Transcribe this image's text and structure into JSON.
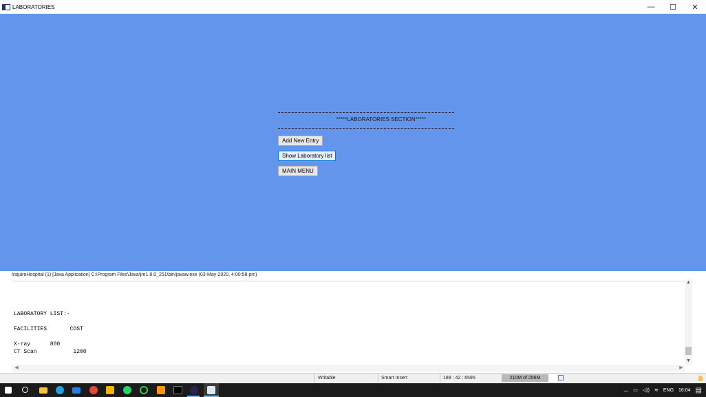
{
  "window": {
    "title": "LABORATORIES",
    "minimize_glyph": "—",
    "maximize_glyph": "☐",
    "close_glyph": "✕"
  },
  "main": {
    "background": "#6495ed",
    "section_title": "*****LABORATORIES SECTION*****",
    "buttons": {
      "add_entry": "Add New Entry",
      "show_list": "Show Laboratory list",
      "main_menu": "MAIN MENU"
    }
  },
  "console": {
    "header": "InquireHospital (1) [Java Application] C:\\Program Files\\Java\\jre1.8.0_251\\bin\\javaw.exe (03-May-2020, 4:00:58 pm)",
    "lines": [
      "LABORATORY LIST:-",
      "",
      "FACILITIES       COST",
      "",
      "X-ray      800",
      "CT Scan           1200"
    ]
  },
  "statusbar": {
    "mode": "Writable",
    "insert": "Smart Insert",
    "position": "189 : 42 : 6595",
    "heap": "210M of 256M"
  },
  "taskbar": {
    "icons": [
      "windows-start-icon",
      "search-icon",
      "file-explorer-icon",
      "edge-icon",
      "mail-icon",
      "chrome-icon",
      "store-icon",
      "whatsapp-icon",
      "refresh-icon",
      "sublime-icon",
      "terminal-icon",
      "eclipse-icon",
      "java-app-icon"
    ],
    "tray": {
      "language": "ENG",
      "time": "16:04"
    }
  }
}
